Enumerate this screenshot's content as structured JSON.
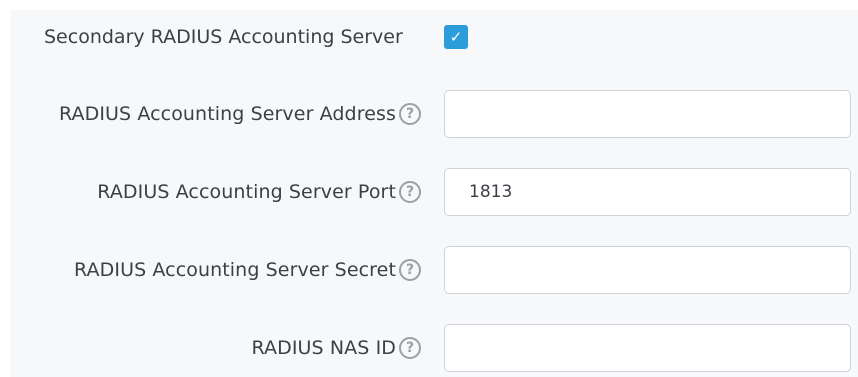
{
  "form": {
    "secondary_server": {
      "label": "Secondary RADIUS Accounting Server",
      "checked": true,
      "check_glyph": "✓"
    },
    "server_address": {
      "label": "RADIUS Accounting Server Address",
      "value": "",
      "help_glyph": "?"
    },
    "server_port": {
      "label": "RADIUS Accounting Server Port",
      "value": "1813",
      "help_glyph": "?"
    },
    "server_secret": {
      "label": "RADIUS Accounting Server Secret",
      "value": "",
      "help_glyph": "?"
    },
    "nas_id": {
      "label": "RADIUS NAS ID",
      "value": "",
      "help_glyph": "?"
    }
  },
  "colors": {
    "accent": "#2d9cdb",
    "panel_background": "#f7f8fa",
    "label_text": "#3c3f44",
    "help_icon": "#9aa0a6",
    "input_border": "#cfd3d8"
  },
  "icons": {
    "checkbox": "checkbox-checked-icon",
    "help": "help-circle-icon"
  }
}
